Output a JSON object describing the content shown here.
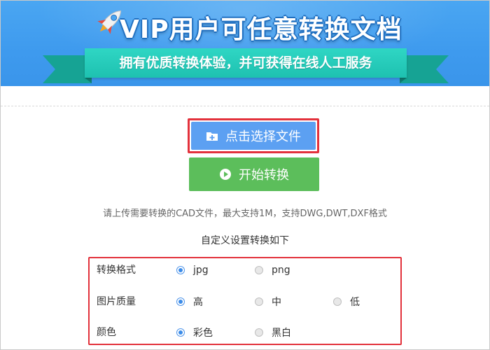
{
  "banner": {
    "title": "VIP用户可任意转换文档",
    "subtitle": "拥有优质转换体验，并可获得在线人工服务"
  },
  "buttons": {
    "select_file": "点击选择文件",
    "start_convert": "开始转换"
  },
  "hint": "请上传需要转换的CAD文件，最大支持1M，支持DWG,DWT,DXF格式",
  "settings_title": "自定义设置转换如下",
  "settings": {
    "format": {
      "label": "转换格式",
      "options": [
        "jpg",
        "png"
      ],
      "selected": "jpg"
    },
    "quality": {
      "label": "图片质量",
      "options": [
        "高",
        "中",
        "低"
      ],
      "selected": "高"
    },
    "color": {
      "label": "颜色",
      "options": [
        "彩色",
        "黑白"
      ],
      "selected": "彩色"
    }
  },
  "colors": {
    "banner_blue": "#3e9aee",
    "ribbon_teal": "#1ec1b0",
    "select_blue": "#5ca0f2",
    "start_green": "#5cbe5b",
    "highlight_red": "#e3323c"
  }
}
